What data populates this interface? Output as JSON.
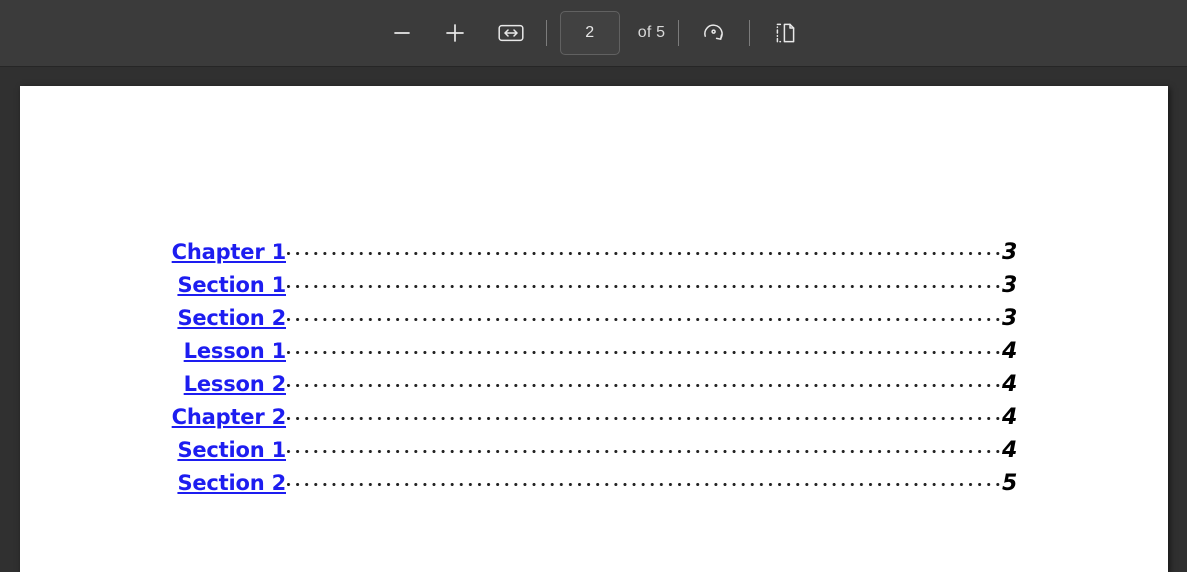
{
  "toolbar": {
    "zoom_out_label": "Zoom out",
    "zoom_out_icon": "minus-icon",
    "zoom_in_label": "Zoom in",
    "zoom_in_icon": "plus-icon",
    "fit_width_label": "Fit to width",
    "fit_width_icon": "fit-width-icon",
    "page_number_value": "2",
    "page_number_placeholder": "",
    "page_count_label": "of 5",
    "rotate_label": "Rotate clockwise",
    "rotate_icon": "rotate-clockwise-icon",
    "page_view_label": "Page view",
    "page_view_icon": "document-page-icon"
  },
  "document": {
    "toc": {
      "entries": [
        {
          "label": "Chapter 1",
          "page": "3",
          "level": 0
        },
        {
          "label": "Section 1",
          "page": "3",
          "level": 1
        },
        {
          "label": "Section 2",
          "page": "3",
          "level": 1
        },
        {
          "label": "Lesson 1",
          "page": "4",
          "level": 2
        },
        {
          "label": "Lesson 2",
          "page": "4",
          "level": 2
        },
        {
          "label": "Chapter 2",
          "page": "4",
          "level": 0
        },
        {
          "label": "Section 1",
          "page": "4",
          "level": 1
        },
        {
          "label": "Section 2",
          "page": "5",
          "level": 1
        }
      ]
    }
  },
  "colors": {
    "toolbar_bg": "#3b3b3b",
    "viewer_bg": "#303030",
    "page_bg": "#ffffff",
    "link": "#1d1df0",
    "page_number": "#000000",
    "leader_dots": "#222222",
    "toolbar_text": "#d9d9d9"
  }
}
